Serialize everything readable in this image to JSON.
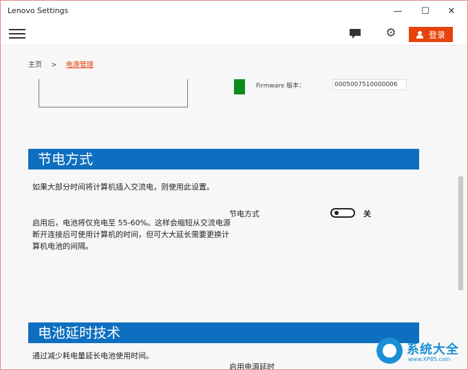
{
  "window": {
    "title": "Lenovo Settings",
    "minimize_glyph": "—",
    "maximize_glyph": "☐",
    "close_glyph": "✕"
  },
  "toolbar": {
    "menu_icon": "hamburger-menu-icon",
    "feedback_icon": "chat-bubble-icon",
    "settings_icon": "gear-icon",
    "gear_glyph": "⚙",
    "login_label": "登录",
    "accent_color": "#e8420b"
  },
  "breadcrumb": {
    "home": "主页",
    "separator": ">",
    "current": "电源管理"
  },
  "firmware": {
    "label": "Firmware 版本：",
    "value": "0005007510000006"
  },
  "sections": [
    {
      "title": "节电方式",
      "paragraph1": "如果大部分时间将计算机插入交流电，则使用此设置。",
      "paragraph2": "启用后，电池将仅充电至 55-60%。这样会缩短从交流电源断开连接后可使用计算机的时间，但可大大延长需要更换计算机电池的间隔。",
      "setting_label": "节电方式",
      "toggle_state": "关",
      "toggle_on": false
    },
    {
      "title": "电池延时技术",
      "paragraph1": "通过减少耗电量延长电池使用时间。",
      "setting_label": "启用电源延时"
    }
  ],
  "watermark": {
    "title": "系统大全",
    "url": "www.XP85.com"
  },
  "colors": {
    "section_header": "#0e6fc0",
    "firmware_indicator": "#0c8a1a"
  }
}
